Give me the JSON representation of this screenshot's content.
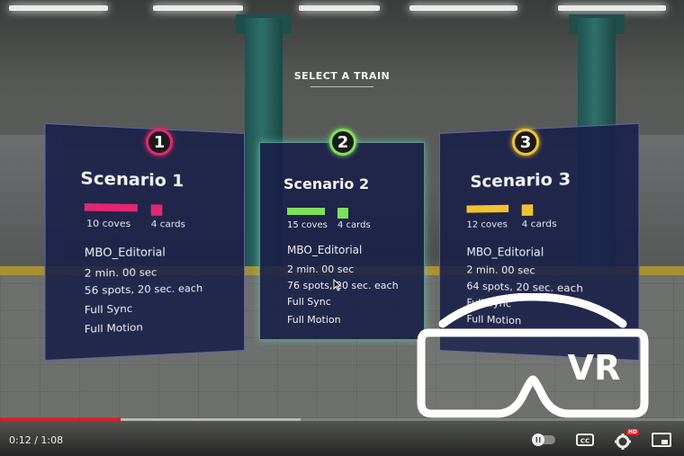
{
  "header": {
    "title": "SELECT A TRAIN"
  },
  "scenarios": [
    {
      "number": "1",
      "name": "Scenario 1",
      "coves": "10 coves",
      "cards": "4 cards",
      "editorial": "MBO_Editorial",
      "duration": "2 min. 00 sec",
      "spots": "56 spots,  20 sec. each",
      "sync": "Full Sync",
      "motion": "Full Motion",
      "color": "#e3266f"
    },
    {
      "number": "2",
      "name": "Scenario 2",
      "coves": "15 coves",
      "cards": "4 cards",
      "editorial": "MBO_Editorial",
      "duration": "2 min. 00 sec",
      "spots": "76 spots,  20 sec. each",
      "sync": "Full Sync",
      "motion": "Full Motion",
      "color": "#7fe05c"
    },
    {
      "number": "3",
      "name": "Scenario 3",
      "coves": "12 coves",
      "cards": "4 cards",
      "editorial": "MBO_Editorial",
      "duration": "2 min. 00 sec",
      "spots": "64 spots,  20 sec. each",
      "sync": "Full Sync",
      "motion": "Full Motion",
      "color": "#f3c12e"
    }
  ],
  "overlay": {
    "vr_label": "VR"
  },
  "player": {
    "time": "0:12 / 1:08",
    "progress_played": 0.176,
    "progress_buffered": 0.44,
    "hd_badge": "HD",
    "icons": [
      "autoplay-toggle-icon",
      "captions-icon",
      "settings-icon",
      "miniplayer-icon"
    ]
  }
}
